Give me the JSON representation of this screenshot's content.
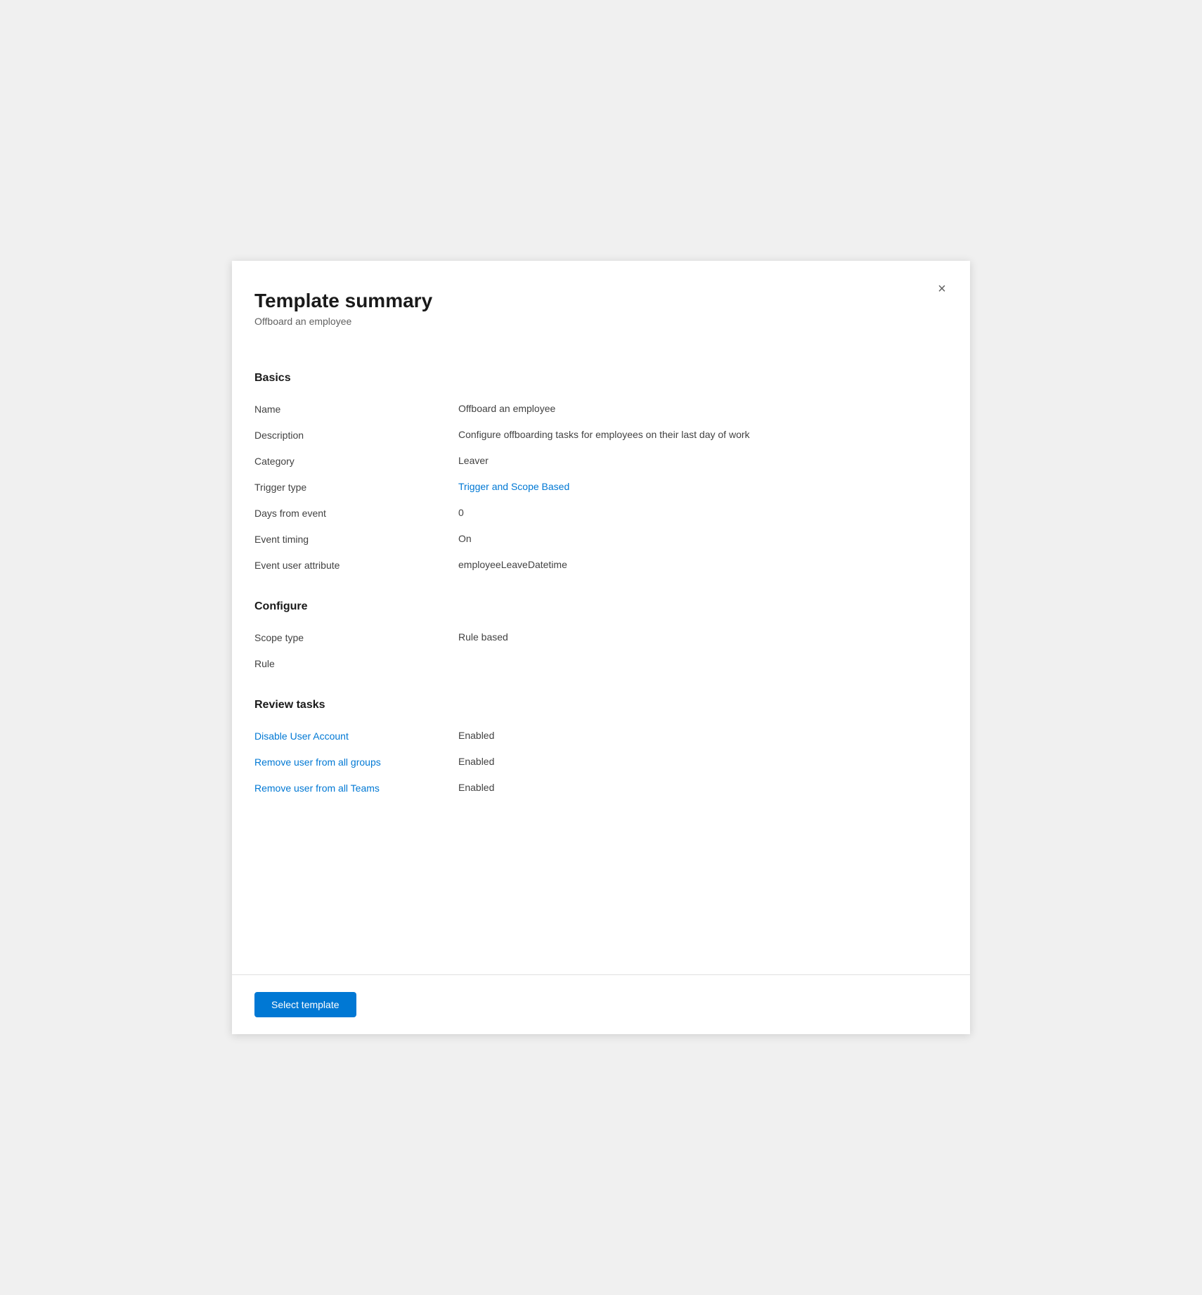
{
  "panel": {
    "title": "Template summary",
    "subtitle": "Offboard an employee",
    "close_label": "×"
  },
  "sections": {
    "basics": {
      "title": "Basics",
      "fields": [
        {
          "label": "Name",
          "value": "Offboard an employee",
          "is_link": false
        },
        {
          "label": "Description",
          "value": "Configure offboarding tasks for employees on their last day of work",
          "is_link": false
        },
        {
          "label": "Category",
          "value": "Leaver",
          "is_link": false
        },
        {
          "label": "Trigger type",
          "value": "Trigger and Scope Based",
          "is_link": true
        },
        {
          "label": "Days from event",
          "value": "0",
          "is_link": false
        },
        {
          "label": "Event timing",
          "value": "On",
          "is_link": false
        },
        {
          "label": "Event user attribute",
          "value": "employeeLeaveDatetime",
          "is_link": false
        }
      ]
    },
    "configure": {
      "title": "Configure",
      "fields": [
        {
          "label": "Scope type",
          "value": "Rule based",
          "is_link": false
        },
        {
          "label": "Rule",
          "value": "",
          "is_link": false
        }
      ]
    },
    "review_tasks": {
      "title": "Review tasks",
      "fields": [
        {
          "label": "Disable User Account",
          "value": "Enabled",
          "is_link": true
        },
        {
          "label": "Remove user from all groups",
          "value": "Enabled",
          "is_link": true
        },
        {
          "label": "Remove user from all Teams",
          "value": "Enabled",
          "is_link": true
        }
      ]
    }
  },
  "footer": {
    "select_template_label": "Select template"
  }
}
